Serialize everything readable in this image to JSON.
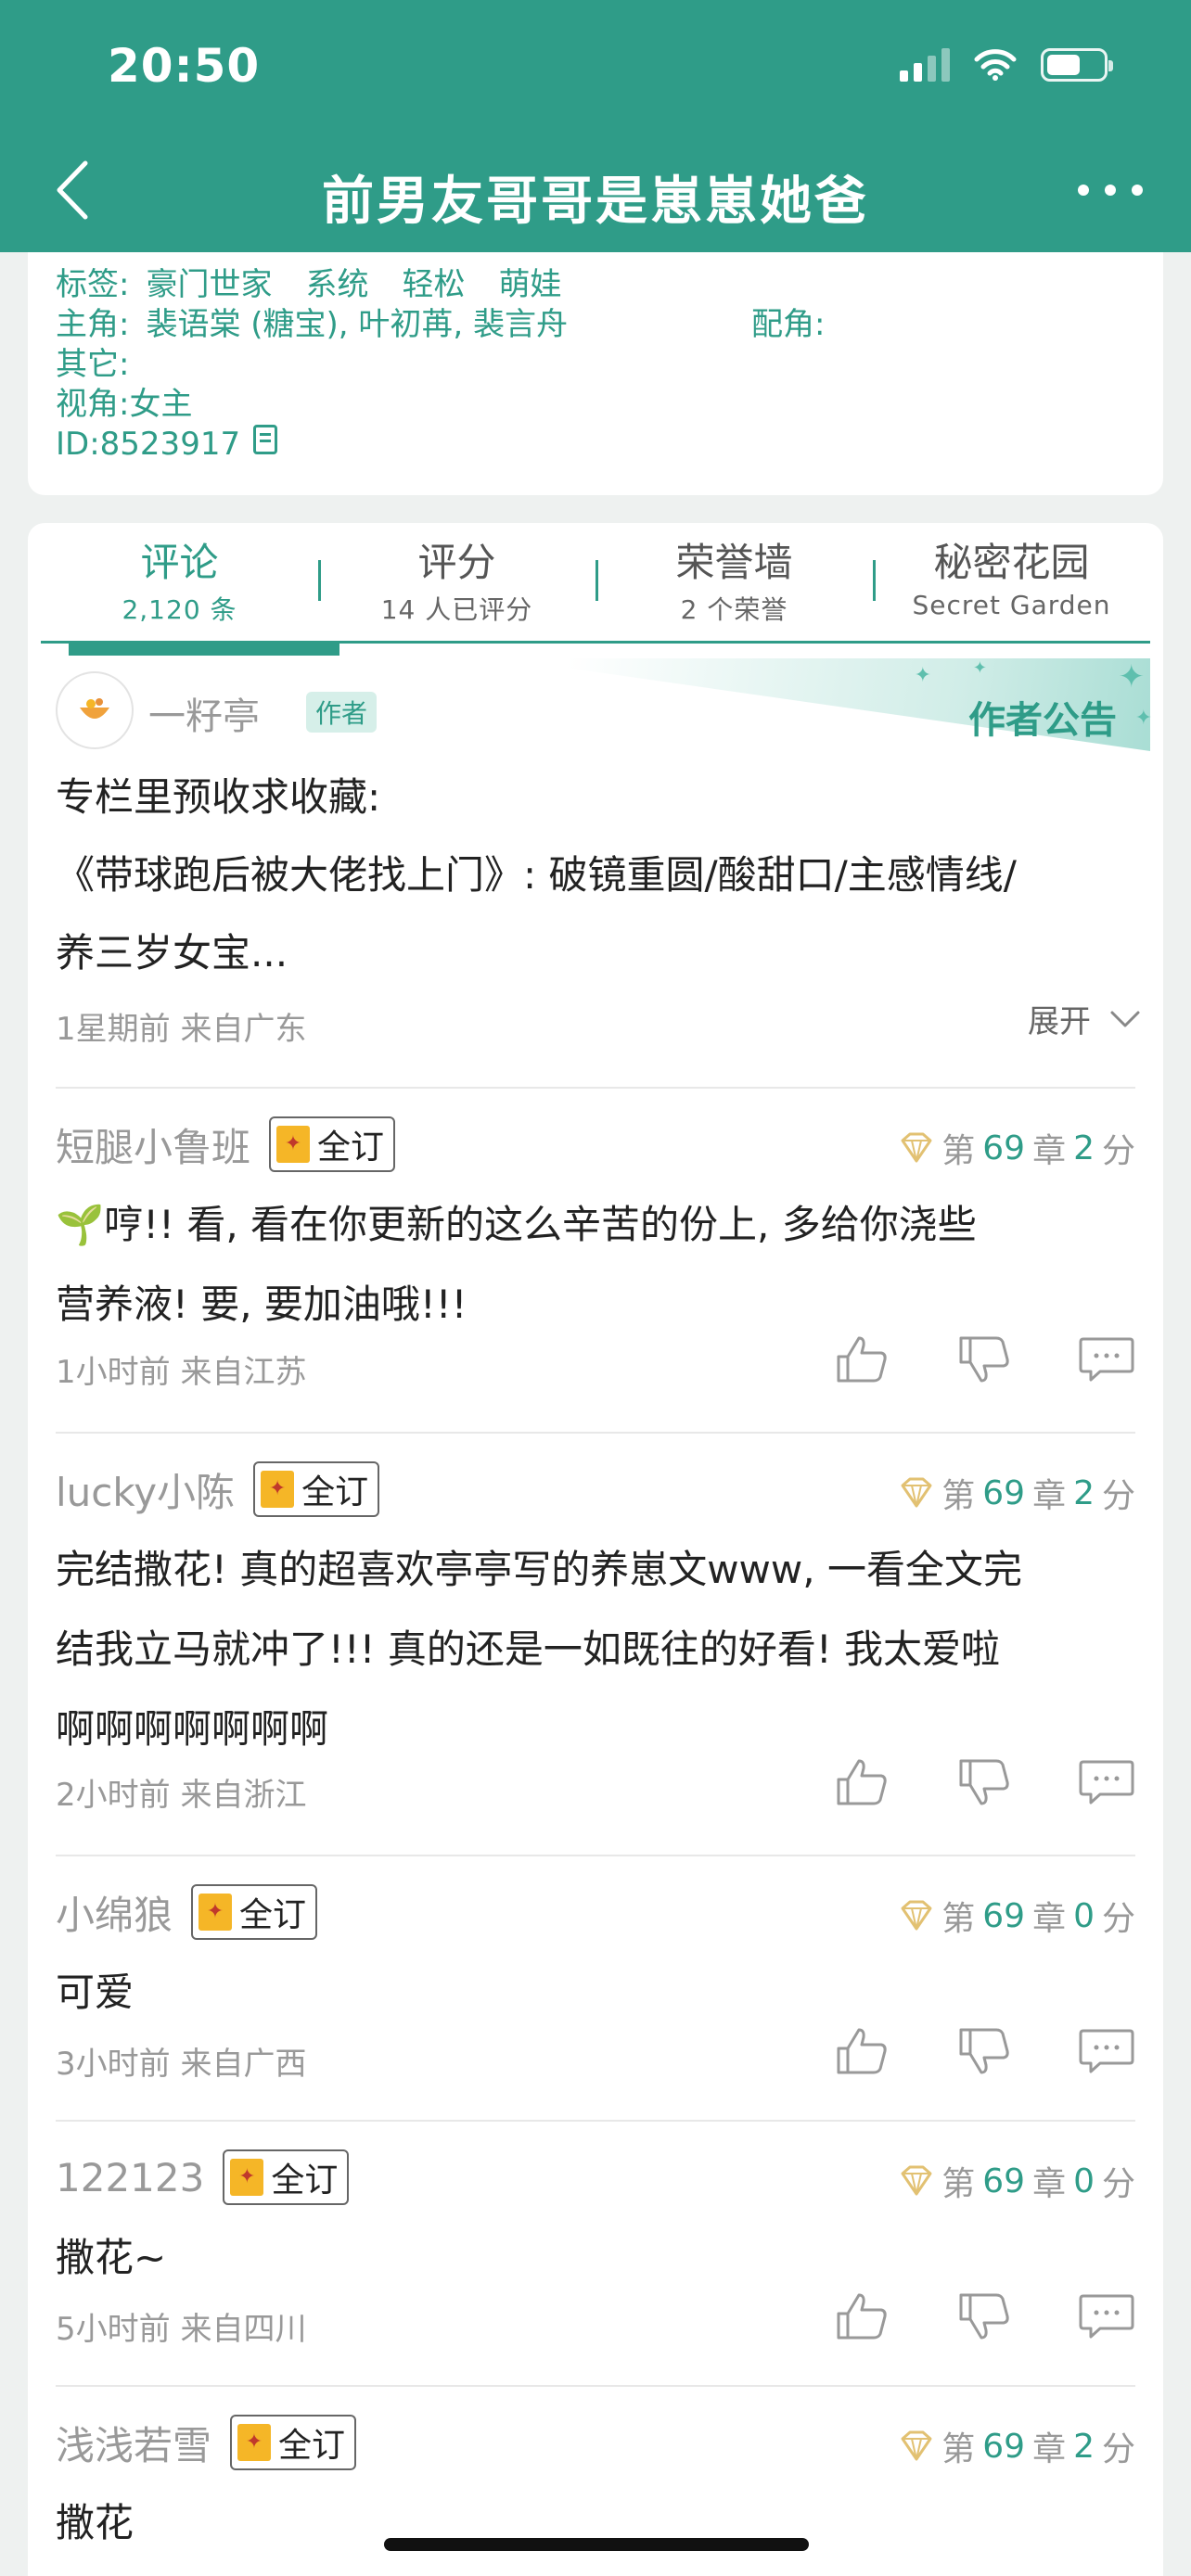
{
  "status_bar": {
    "time": "20:50"
  },
  "header": {
    "title": "前男友哥哥是崽崽她爸"
  },
  "info": {
    "tags_label": "标签:",
    "tags": [
      "豪门世家",
      "系统",
      "轻松",
      "萌娃"
    ],
    "protagonist_label": "主角:",
    "protagonist": "裴语棠 (糖宝), 叶初苒, 裴言舟",
    "support_label": "配角:",
    "other_label": "其它:",
    "pov": "视角:女主",
    "id": "ID:8523917"
  },
  "tabs": [
    {
      "title": "评论",
      "sub": "2,120 条"
    },
    {
      "title": "评分",
      "sub": "14 人已评分"
    },
    {
      "title": "荣誉墙",
      "sub": "2 个荣誉"
    },
    {
      "title": "秘密花园",
      "sub": "Secret Garden"
    }
  ],
  "announcement": {
    "author": "一籽亭",
    "author_badge": "作者",
    "label": "作者公告",
    "lines": [
      "专栏里预收求收藏:",
      "《带球跑后被大佬找上门》: 破镜重圆/酸甜口/主感情线/",
      "养三岁女宝..."
    ],
    "meta": "1星期前  来自广东",
    "expand": "展开"
  },
  "comments": [
    {
      "name": "短腿小鲁班",
      "badge": "全订",
      "chapter_prefix": "第",
      "chapter": "69",
      "chapter_unit": "章",
      "score": "2",
      "score_unit": "分",
      "lines": [
        "🌱哼!! 看, 看在你更新的这么辛苦的份上, 多给你浇些",
        "营养液! 要, 要加油哦!!!"
      ],
      "meta": "1小时前  来自江苏"
    },
    {
      "name": "lucky小陈",
      "badge": "全订",
      "chapter_prefix": "第",
      "chapter": "69",
      "chapter_unit": "章",
      "score": "2",
      "score_unit": "分",
      "lines": [
        "完结撒花! 真的超喜欢亭亭写的养崽文www, 一看全文完",
        "结我立马就冲了!!! 真的还是一如既往的好看! 我太爱啦",
        "啊啊啊啊啊啊啊"
      ],
      "meta": "2小时前  来自浙江"
    },
    {
      "name": "小绵狼",
      "badge": "全订",
      "chapter_prefix": "第",
      "chapter": "69",
      "chapter_unit": "章",
      "score": "0",
      "score_unit": "分",
      "lines": [
        "可爱"
      ],
      "meta": "3小时前  来自广西"
    },
    {
      "name": "122123",
      "badge": "全订",
      "chapter_prefix": "第",
      "chapter": "69",
      "chapter_unit": "章",
      "score": "0",
      "score_unit": "分",
      "lines": [
        "撒花~"
      ],
      "meta": "5小时前  来自四川"
    },
    {
      "name": "浅浅若雪",
      "badge": "全订",
      "chapter_prefix": "第",
      "chapter": "69",
      "chapter_unit": "章",
      "score": "2",
      "score_unit": "分",
      "lines": [
        "撒花"
      ],
      "meta": ""
    }
  ],
  "colors": {
    "brand": "#2f9c88",
    "badge": "#f5b627",
    "muted": "#999999"
  }
}
